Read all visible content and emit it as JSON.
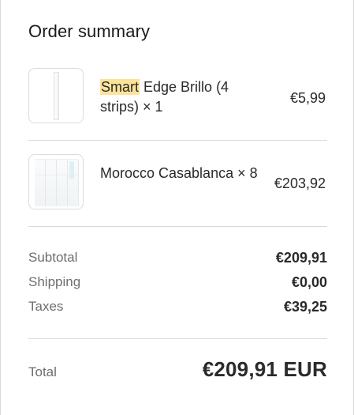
{
  "order": {
    "title": "Order summary",
    "items": [
      {
        "name_highlight": "Smart",
        "name_rest": " Edge Brillo (4 strips) × 1",
        "price": "€5,99",
        "thumbnail": "light-strip-product-image"
      },
      {
        "name": "Morocco Casablanca × 8",
        "price": "€203,92",
        "thumbnail": "white-tile-product-image"
      }
    ],
    "subtotal_label": "Subtotal",
    "subtotal_value": "€209,91",
    "shipping_label": "Shipping",
    "shipping_value": "€0,00",
    "taxes_label": "Taxes",
    "taxes_value": "€39,25",
    "total_label": "Total",
    "total_value": "€209,91 EUR"
  },
  "colors": {
    "highlight": "#fbe39a",
    "divider": "#d9d9d9",
    "label_gray": "#6e6e6e",
    "text": "#2a2a2a"
  }
}
